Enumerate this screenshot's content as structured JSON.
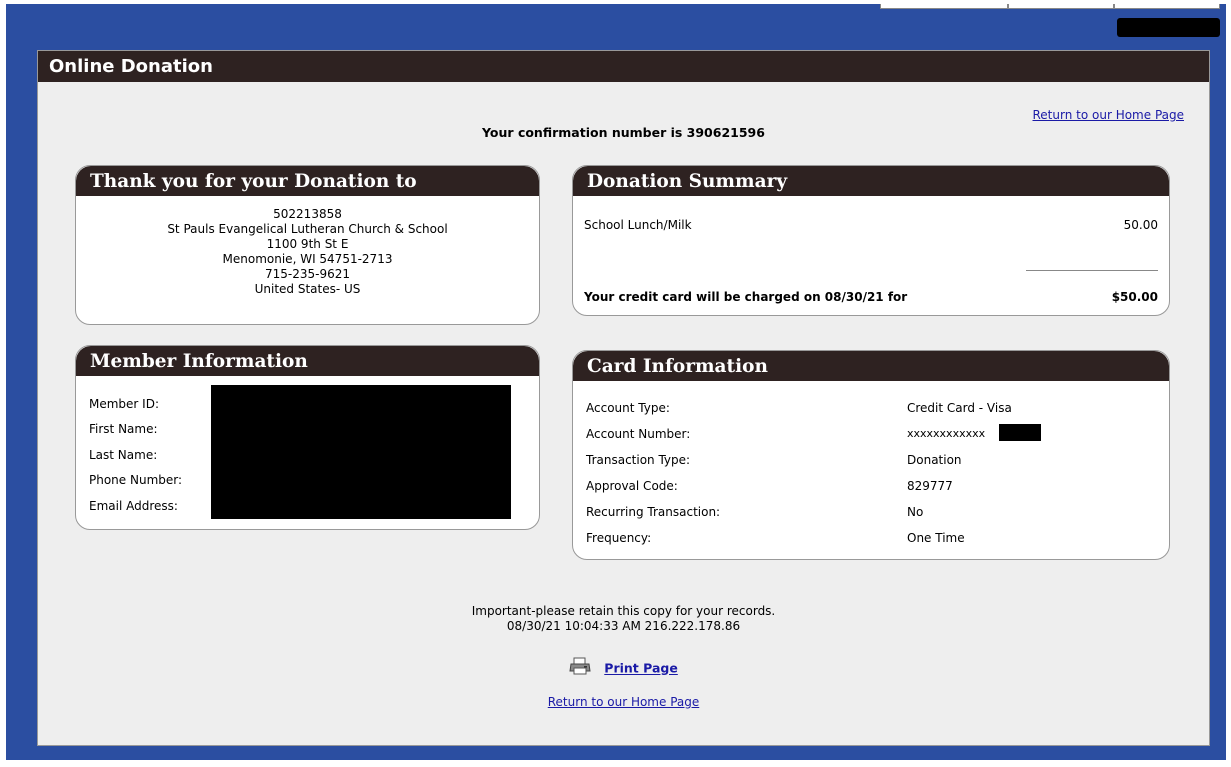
{
  "header": {
    "title": "Online Donation"
  },
  "links": {
    "home_top": "Return to our Home Page",
    "home_bottom": "Return to our Home Page",
    "print": "Print Page"
  },
  "confirmation": "Your confirmation number is 390621596",
  "thankyou": {
    "title": "Thank you for your Donation to",
    "lines": [
      "502213858",
      "St Pauls Evangelical Lutheran Church & School",
      "1100 9th St E",
      "Menomonie, WI 54751-2713",
      "715-235-9621",
      "United States- US"
    ]
  },
  "summary": {
    "title": "Donation Summary",
    "item_label": "School Lunch/Milk",
    "item_amount": "50.00",
    "charge_text": "Your credit card will be charged on 08/30/21 for",
    "charge_total": "$50.00"
  },
  "member": {
    "title": "Member Information",
    "labels": [
      "Member ID:",
      "First Name:",
      "Last Name:",
      "Phone Number:",
      "Email Address:"
    ]
  },
  "card": {
    "title": "Card Information",
    "rows": [
      {
        "label": "Account Type:",
        "value": "Credit Card - Visa"
      },
      {
        "label": "Account Number:",
        "value": "xxxxxxxxxxxx"
      },
      {
        "label": "Transaction Type:",
        "value": "Donation"
      },
      {
        "label": "Approval Code:",
        "value": "829777"
      },
      {
        "label": "Recurring Transaction:",
        "value": "No"
      },
      {
        "label": "Frequency:",
        "value": "One Time"
      }
    ]
  },
  "footer": {
    "notice": "Important-please retain this copy for your records.",
    "timestamp": "08/30/21 10:04:33 AM 216.222.178.86"
  }
}
